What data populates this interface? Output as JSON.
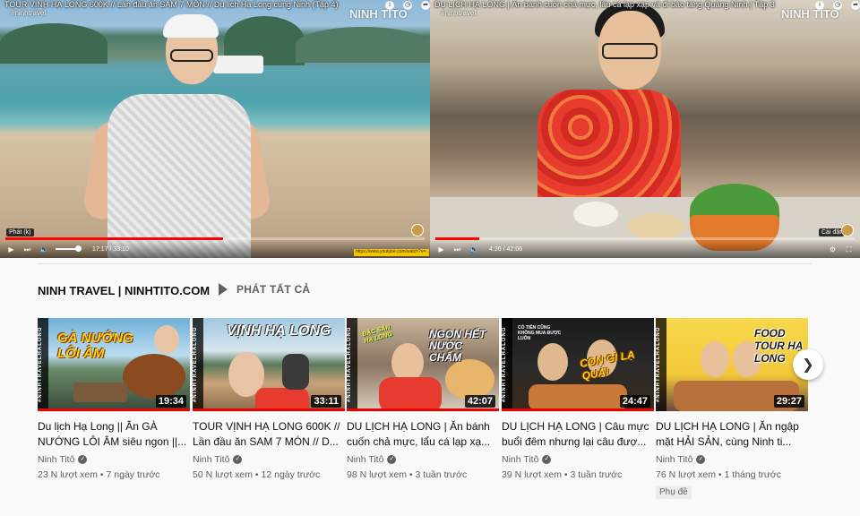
{
  "player_left": {
    "title": "TOUR VỊNH HẠ LONG 600K // Lần đầu ăn SAM 7 MÓN // Du lịch Hạ Long cùng Ninh (Tập 4)",
    "channel": "#ninhtravel",
    "watermark": "NINH TITO",
    "tooltip": "Phát (k)",
    "time": "17:17 / 33:10",
    "progress": 0.52,
    "url_text": "https://www.youtube.com/watch?v=..."
  },
  "player_right": {
    "title": "DU LỊCH HẠ LONG | Ăn bánh cuốn chả mực, lẩu cá lạp xạp và đi bảo tàng Quảng Ninh | Tập 3",
    "channel": "#ninhtravel",
    "watermark": "NINH TITO",
    "tooltip": "Cài đặt",
    "time": "4:26 / 42:06",
    "progress": 0.105
  },
  "shelf": {
    "title": "NINH TRAVEL | NINHTITO.COM",
    "play_all": "PHÁT TẤT CẢ"
  },
  "videos": [
    {
      "thumb_text": "GÀ NƯỚNG LÔI ÂM",
      "side_text": "#NINHTRAVELHALONG",
      "duration": "19:34",
      "title": "Du lịch Hạ Long || Ăn GÀ NƯỚNG LÔI ÂM siêu ngon ||...",
      "channel": "Ninh Titô",
      "meta": "23 N lượt xem • 7 ngày trước"
    },
    {
      "thumb_text": "VỊNH HẠ LONG",
      "side_text": "#NINHTRAVELHALONG",
      "duration": "33:11",
      "title": "TOUR VỊNH HẠ LONG 600K // Lần đầu ăn SAM 7 MÓN // D...",
      "channel": "Ninh Titô",
      "meta": "50 N lượt xem • 12 ngày trước"
    },
    {
      "thumb_text": "NGON HẾT NƯỚC CHẤM",
      "thumb_text2": "ĐẶC SẢN HẠ LONG",
      "side_text": "#NINHTRAVELHALONG",
      "duration": "42:07",
      "title": "DU LỊCH HẠ LONG | Ăn bánh cuốn chả mực, lẩu cá lạp xạ...",
      "channel": "Ninh Titô",
      "meta": "98 N lượt xem • 3 tuần trước"
    },
    {
      "thumb_text": "CON GÌ LẠ QUÁ!",
      "thumb_text2": "CÓ TIỀN CŨNG KHÔNG MUA ĐƯỢC LUÔN",
      "side_text": "#NINHTRAVELHALONG",
      "duration": "24:47",
      "title": "DU LỊCH HẠ LONG | Câu mực buổi đêm nhưng lại câu đượ...",
      "channel": "Ninh Titô",
      "meta": "39 N lượt xem • 3 tuần trước"
    },
    {
      "thumb_text": "FOOD TOUR HẠ LONG",
      "side_text": "#NINHTRAVELHALONG",
      "duration": "29:27",
      "title": "DU LỊCH HẠ LONG | Ăn ngập mặt HẢI SẢN, cùng Ninh ti...",
      "channel": "Ninh Titô",
      "meta": "76 N lượt xem • 1 tháng trước",
      "badge": "Phụ đề"
    }
  ],
  "icons": {
    "info": "info-icon",
    "clock": "watch-later-icon",
    "share": "share-icon",
    "play": "play-icon",
    "next": "next-icon",
    "volume": "volume-icon",
    "chevron": "chevron-right-icon"
  }
}
